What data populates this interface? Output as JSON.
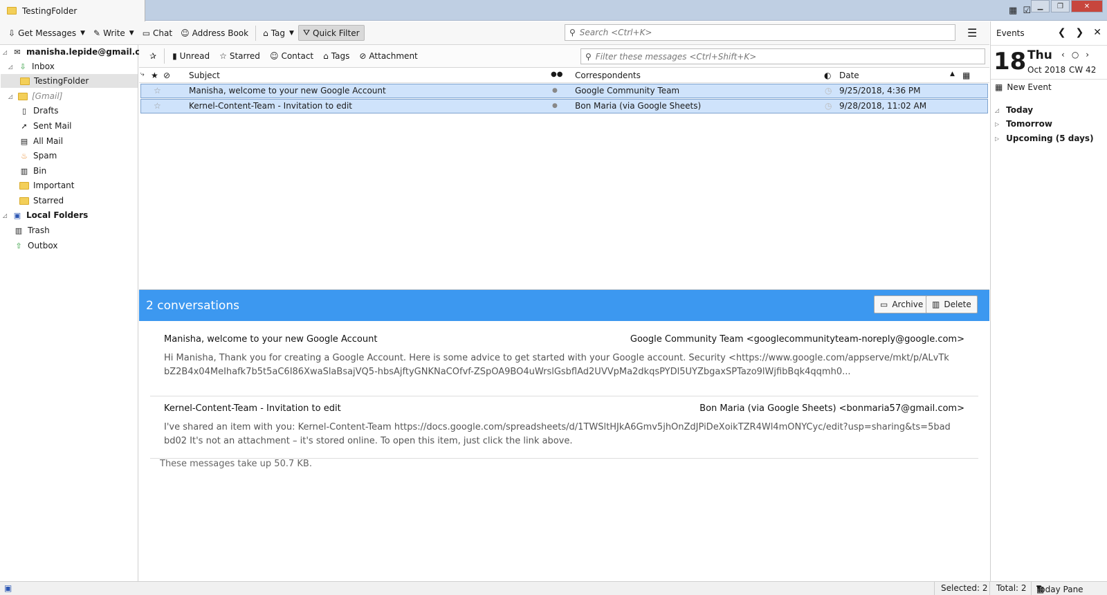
{
  "window": {
    "tab_title": "TestingFolder"
  },
  "toolbar": {
    "get_messages": "Get Messages",
    "write": "Write",
    "chat": "Chat",
    "address_book": "Address Book",
    "tag": "Tag",
    "quick_filter": "Quick Filter",
    "search_placeholder": "Search <Ctrl+K>"
  },
  "sidebar": {
    "account": "manisha.lepide@gmail.com",
    "inbox": "Inbox",
    "testing_folder": "TestingFolder",
    "gmail": "[Gmail]",
    "drafts": "Drafts",
    "sent_mail": "Sent Mail",
    "all_mail": "All Mail",
    "spam": "Spam",
    "bin": "Bin",
    "important": "Important",
    "starred": "Starred",
    "local_folders": "Local Folders",
    "trash": "Trash",
    "outbox": "Outbox"
  },
  "quickfilter": {
    "unread": "Unread",
    "starred": "Starred",
    "contact": "Contact",
    "tags": "Tags",
    "attachment": "Attachment",
    "filter_placeholder": "Filter these messages <Ctrl+Shift+K>"
  },
  "columns": {
    "subject": "Subject",
    "correspondents": "Correspondents",
    "date": "Date"
  },
  "messages": [
    {
      "subject": "Manisha, welcome to your new Google Account",
      "correspondent": "Google Community Team",
      "date": "9/25/2018, 4:36 PM"
    },
    {
      "subject": "Kernel-Content-Team - Invitation to edit",
      "correspondent": "Bon Maria (via Google Sheets)",
      "date": "9/28/2018, 11:02 AM"
    }
  ],
  "summary": {
    "title": "2 conversations",
    "archive": "Archive",
    "delete": "Delete",
    "items": [
      {
        "subject": "Manisha, welcome to your new Google Account",
        "from": "Google Community Team <googlecommunityteam-noreply@google.com>",
        "body": "Hi Manisha, Thank you for creating a Google Account. Here is some advice to get started with your Google account. Security <https://www.google.com/appserve/mkt/p/ALvTkbZ2B4x04MeIhafk7b5t5aC6I86XwaSlaBsajVQ5-hbsAjftyGNKNaCOfvf-ZSpOA9BO4uWrslGsbflAd2UVVpMa2dkqsPYDl5UYZbgaxSPTazo9lWjfibBqk4qqmh0..."
      },
      {
        "subject": "Kernel-Content-Team - Invitation to edit",
        "from": "Bon Maria (via Google Sheets) <bonmaria57@gmail.com>",
        "body": "I've shared an item with you: Kernel-Content-Team https://docs.google.com/spreadsheets/d/1TWSltHJkA6Gmv5jhOnZdJPiDeXoikTZR4Wl4mONYCyc/edit?usp=sharing&ts=5badbd02 It's not an attachment – it's stored online. To open this item, just click the link above."
      }
    ],
    "size_info": "These messages take up 50.7 KB."
  },
  "today_pane": {
    "events_label": "Events",
    "day_number": "18",
    "day_name": "Thu",
    "month_year": "Oct 2018",
    "week": "CW 42",
    "new_event": "New Event",
    "today": "Today",
    "tomorrow": "Tomorrow",
    "upcoming": "Upcoming (5 days)"
  },
  "statusbar": {
    "selected": "Selected: 2",
    "total": "Total: 2",
    "today_pane": "Today Pane"
  }
}
